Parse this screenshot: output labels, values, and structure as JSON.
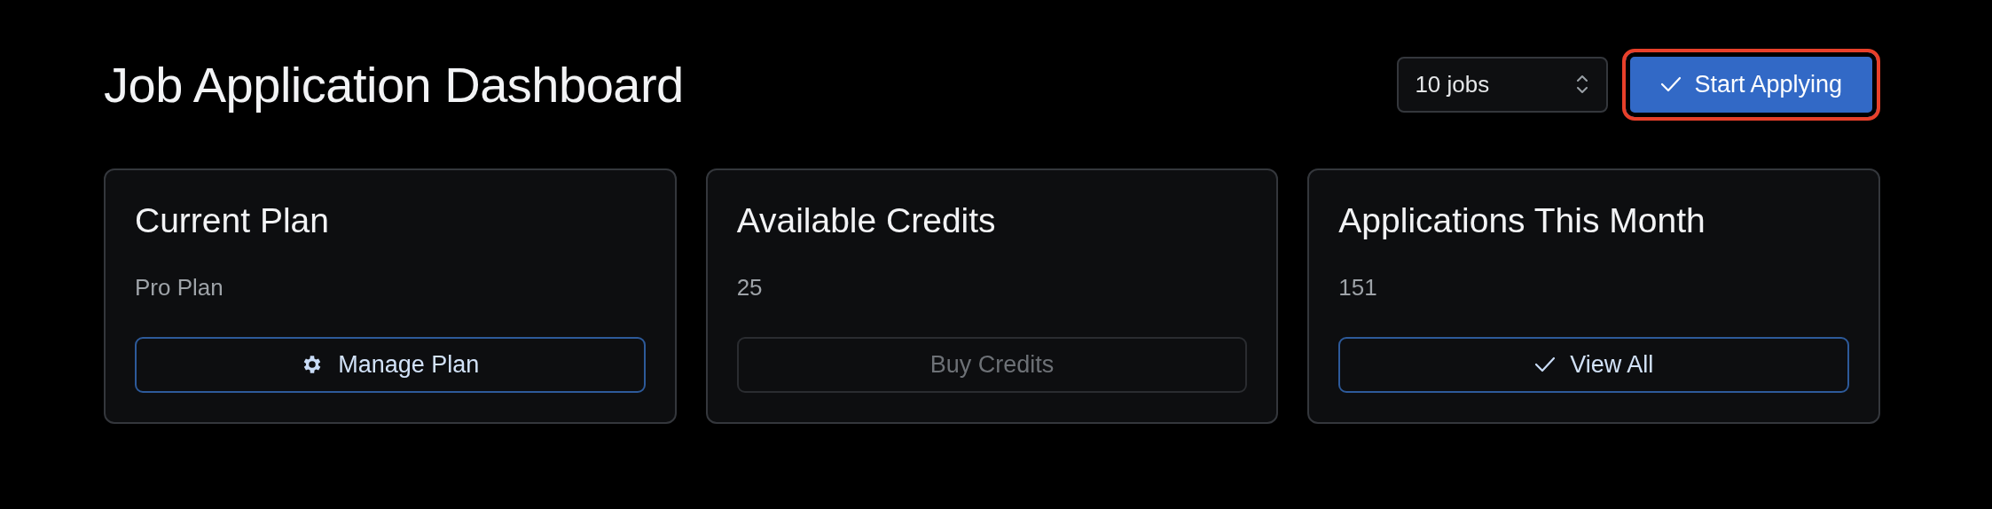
{
  "page": {
    "title": "Job Application Dashboard"
  },
  "job_count_select": {
    "value": "10 jobs"
  },
  "start_button": {
    "label": "Start Applying",
    "focused": true
  },
  "cards": [
    {
      "kind": "plan",
      "title": "Current Plan",
      "value": "Pro Plan",
      "button": {
        "label": "Manage Plan",
        "disabled": false
      }
    },
    {
      "kind": "credits",
      "title": "Available Credits",
      "value": "25",
      "button": {
        "label": "Buy Credits",
        "disabled": true
      }
    },
    {
      "kind": "usage",
      "title": "Applications This Month",
      "value": "151",
      "button": {
        "label": "View All",
        "disabled": false
      }
    }
  ]
}
